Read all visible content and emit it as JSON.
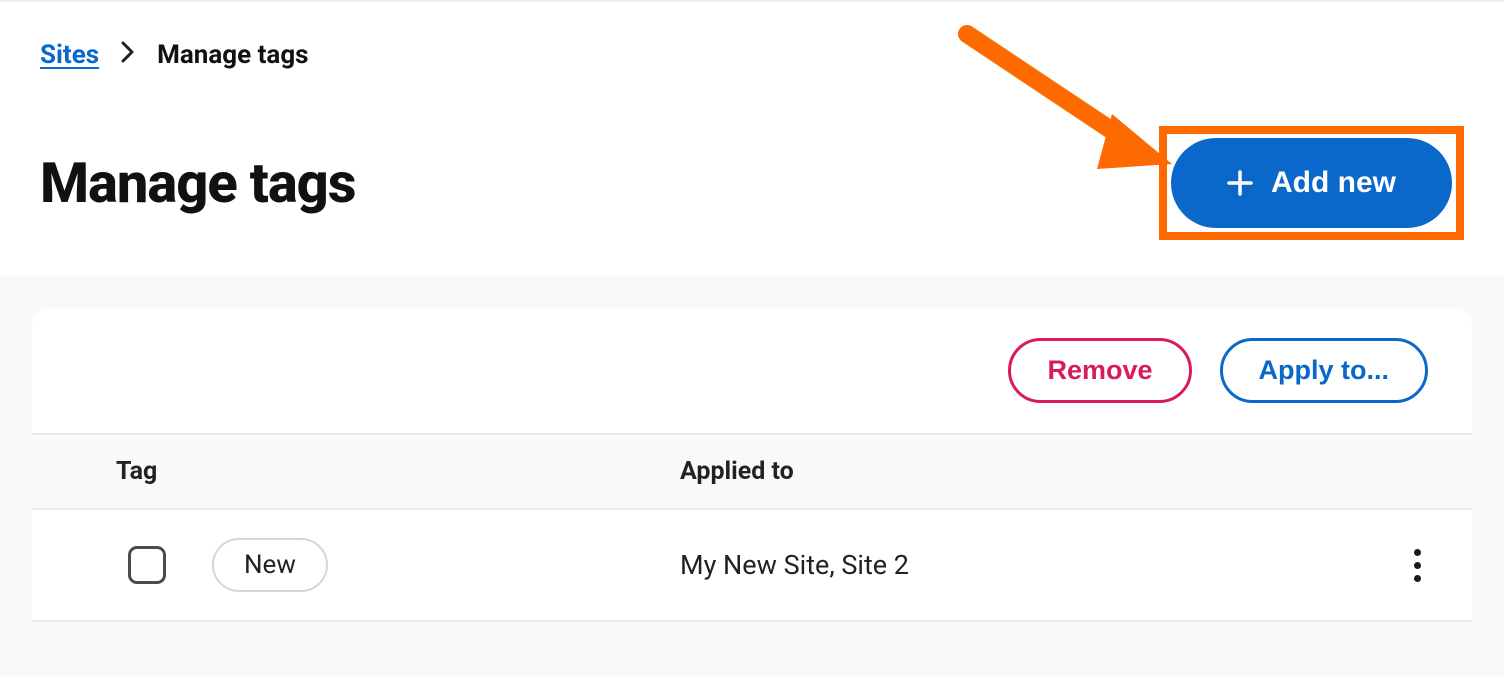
{
  "breadcrumb": {
    "root": "Sites",
    "current": "Manage tags"
  },
  "page": {
    "title": "Manage tags"
  },
  "header_actions": {
    "add_new": "Add new"
  },
  "card_actions": {
    "remove": "Remove",
    "apply_to": "Apply to..."
  },
  "table": {
    "headers": {
      "tag": "Tag",
      "applied_to": "Applied to"
    },
    "rows": [
      {
        "tag": "New",
        "applied_to": "My New Site, Site 2"
      }
    ]
  },
  "colors": {
    "primary": "#0b68cb",
    "danger": "#d81b60",
    "highlight": "#ff6a00"
  }
}
